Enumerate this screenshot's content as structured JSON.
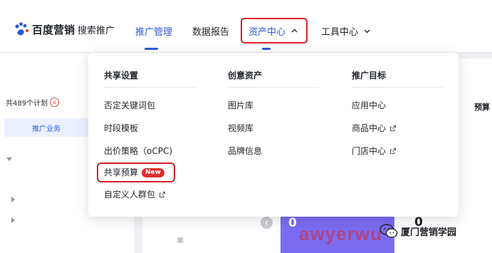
{
  "header": {
    "brand": "百度营销",
    "product": "搜索推广",
    "nav": [
      {
        "label": "推广管理"
      },
      {
        "label": "数据报告"
      },
      {
        "label": "资产中心"
      },
      {
        "label": "工具中心"
      }
    ],
    "active_nav": "推广管理",
    "open_nav": "资产中心"
  },
  "left": {
    "plan_count": "共489个计划",
    "plan_badge": "④",
    "tab_label": "推广业务"
  },
  "main": {
    "budget_header": "预算",
    "card_value": "0",
    "right_value": "0",
    "tiny_label": "单"
  },
  "dropdown": {
    "columns": [
      {
        "title": "共享设置",
        "items": [
          {
            "label": "否定关键词包"
          },
          {
            "label": "时段模板"
          },
          {
            "label": "出价策略（oCPC)"
          },
          {
            "label": "共享预算",
            "badge": "New"
          },
          {
            "label": "自定义人群包",
            "external": true
          }
        ]
      },
      {
        "title": "创意资产",
        "items": [
          {
            "label": "图片库"
          },
          {
            "label": "视频库"
          },
          {
            "label": "品牌信息"
          }
        ]
      },
      {
        "title": "推广目标",
        "items": [
          {
            "label": "应用中心"
          },
          {
            "label": "商品中心",
            "external": true
          },
          {
            "label": "门店中心",
            "external": true
          }
        ]
      }
    ]
  },
  "watermark": {
    "text": "awyerwu",
    "account": "厦门营销学园"
  },
  "colors": {
    "accent": "#2b5bdc",
    "highlight_red": "#d6202a",
    "badge_red": "#e02c2c",
    "card_purple": "#7b6cf0"
  }
}
